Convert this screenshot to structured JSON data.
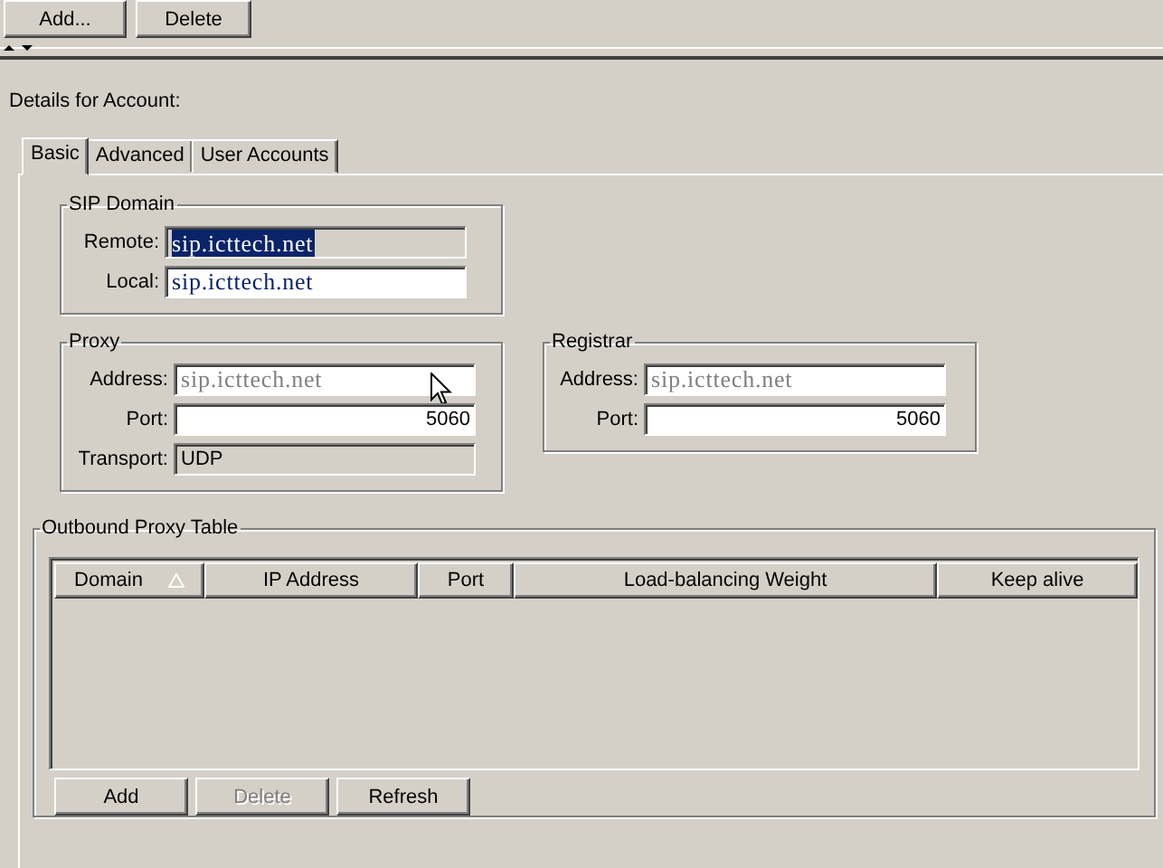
{
  "toolbar": {
    "buttons": [
      {
        "label": "Add..."
      },
      {
        "label": "Delete"
      }
    ]
  },
  "details_label": "Details for Account:",
  "tabs": [
    {
      "label": "Basic",
      "selected": true
    },
    {
      "label": "Advanced",
      "selected": false
    },
    {
      "label": "User Accounts",
      "selected": false
    }
  ],
  "sip_domain": {
    "title": "SIP Domain",
    "fields": [
      {
        "label": "Remote:",
        "kind": "host",
        "value": "sip.icttech.net",
        "readonly": true,
        "highlighted": true
      },
      {
        "label": "Local:",
        "kind": "host",
        "value": "sip.icttech.net",
        "readonly": false,
        "highlighted": false
      }
    ]
  },
  "proxy": {
    "title": "Proxy",
    "fields": [
      {
        "label": "Address:",
        "kind": "host",
        "placeholder": "sip.icttech.net",
        "readonly": false,
        "highlighted": false
      },
      {
        "label": "Port:",
        "kind": "number",
        "value": "5060",
        "readonly": false,
        "highlighted": false
      },
      {
        "label": "Transport:",
        "kind": "text",
        "value": "UDP",
        "readonly": true,
        "highlighted": false
      }
    ]
  },
  "registrar": {
    "title": "Registrar",
    "fields": [
      {
        "label": "Address:",
        "kind": "host",
        "placeholder": "sip.icttech.net",
        "readonly": false,
        "highlighted": false
      },
      {
        "label": "Port:",
        "kind": "number",
        "value": "5060",
        "readonly": false,
        "highlighted": false
      }
    ]
  },
  "outbound_proxy_table": {
    "title": "Outbound Proxy Table",
    "columns": [
      {
        "label": "Domain",
        "sorted": true
      },
      {
        "label": "IP Address",
        "sorted": false
      },
      {
        "label": "Port",
        "sorted": false
      },
      {
        "label": "Load-balancing Weight",
        "sorted": false
      },
      {
        "label": "Keep alive",
        "sorted": false
      }
    ],
    "buttons": [
      {
        "label": "Add",
        "disabled": false
      },
      {
        "label": "Delete",
        "disabled": true
      },
      {
        "label": "Refresh",
        "disabled": false
      }
    ]
  }
}
